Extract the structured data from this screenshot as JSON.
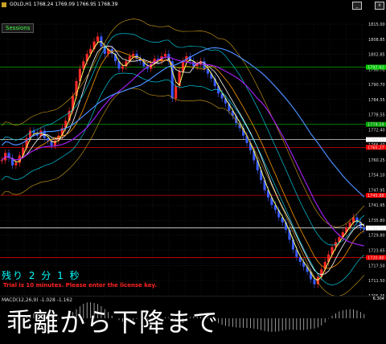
{
  "window": {
    "title": "GOLD,H1  1768.24 1769.09 1766.95 1768.39",
    "sessions_label": "Sessions",
    "minimize_label": "_",
    "close_label": "x"
  },
  "price_axis": {
    "ticks": [
      "1815.00",
      "1808.85",
      "1802.85",
      "1796.70",
      "1790.70",
      "1784.55",
      "1778.55",
      "1772.40",
      "1766.40",
      "1760.25",
      "1754.10",
      "1747.95",
      "1741.95",
      "1735.80",
      "1729.80",
      "1723.65",
      "1717.50",
      "1711.50",
      "1705.35"
    ],
    "highlighted": [
      {
        "label": "1797.62",
        "color": "#00cc00"
      },
      {
        "label": "1774.54",
        "color": "#00aa00"
      },
      {
        "label": "1768.39",
        "color": "#ffffff"
      },
      {
        "label": "1765.27",
        "color": "#ff0000"
      },
      {
        "label": "1745.88",
        "color": "#ff0000"
      },
      {
        "label": "1732.71",
        "color": "#ffffff"
      },
      {
        "label": "1720.80",
        "color": "#ff0000"
      }
    ]
  },
  "overlay": {
    "countdown": "残り 2 分 1 秒",
    "trial_notice": "Trial is 10 minutes. Please enter the license key.",
    "caption": "乖離から下降まで"
  },
  "macd": {
    "label": "MACD(12,26,9) -1.028 -1.162",
    "top_value": "6.304"
  },
  "chart_data": {
    "type": "candlestick",
    "symbol": "GOLD",
    "timeframe": "H1",
    "ylim": [
      1705.35,
      1815.0
    ],
    "close_series": [
      1760,
      1763,
      1761,
      1758,
      1759,
      1762,
      1765,
      1769,
      1772,
      1771,
      1770,
      1772,
      1769,
      1768,
      1766,
      1768,
      1770,
      1773,
      1776,
      1780,
      1786,
      1792,
      1797,
      1800,
      1803,
      1805,
      1808,
      1810,
      1806,
      1803,
      1805,
      1803,
      1800,
      1797,
      1798,
      1800,
      1802,
      1803,
      1801,
      1800,
      1798,
      1797,
      1799,
      1801,
      1800,
      1802,
      1803,
      1800,
      1785,
      1790,
      1796,
      1800,
      1802,
      1800,
      1798,
      1799,
      1800,
      1797,
      1795,
      1793,
      1790,
      1787,
      1785,
      1783,
      1780,
      1778,
      1775,
      1773,
      1770,
      1767,
      1764,
      1760,
      1756,
      1752,
      1748,
      1745,
      1742,
      1740,
      1737,
      1735,
      1732,
      1728,
      1724,
      1721,
      1719,
      1717,
      1715,
      1712,
      1710,
      1713,
      1716,
      1719,
      1722,
      1725,
      1727,
      1729,
      1731,
      1733,
      1735,
      1737,
      1735,
      1733,
      1732
    ]
  }
}
